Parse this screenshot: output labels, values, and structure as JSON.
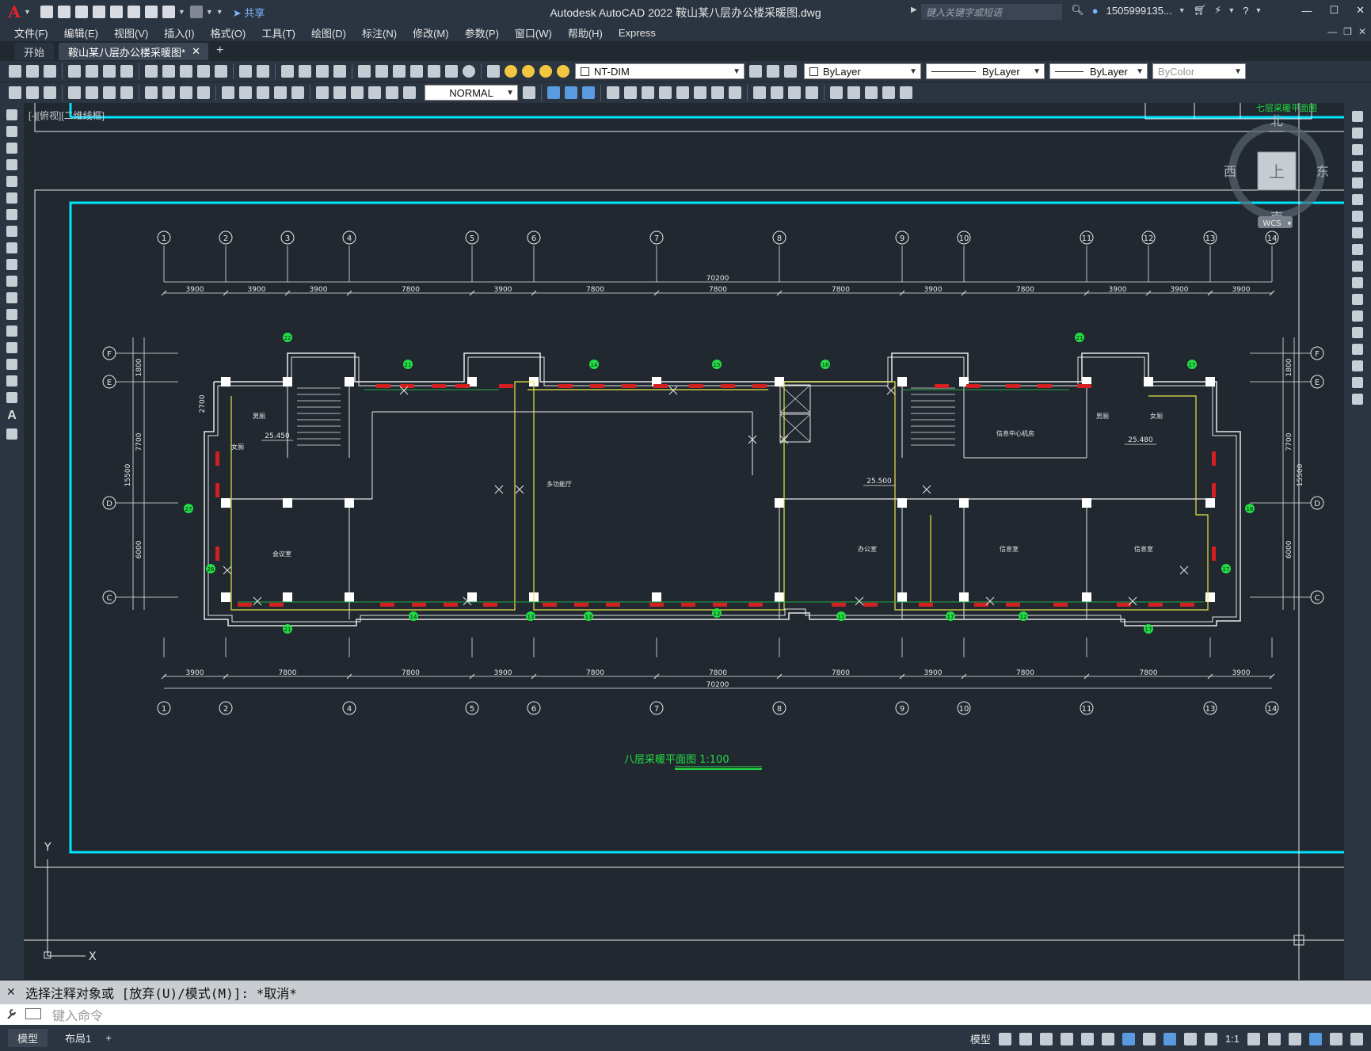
{
  "app": {
    "title": "Autodesk AutoCAD 2022    鞍山某八层办公楼采暖图.dwg",
    "logo": "A",
    "share_label": "共享",
    "search_placeholder": "键入关键字或短语",
    "user": "1505999135...",
    "window_controls": [
      "—",
      "☐",
      "✕"
    ]
  },
  "menu": [
    "文件(F)",
    "编辑(E)",
    "视图(V)",
    "插入(I)",
    "格式(O)",
    "工具(T)",
    "绘图(D)",
    "标注(N)",
    "修改(M)",
    "参数(P)",
    "窗口(W)",
    "帮助(H)",
    "Express"
  ],
  "tabs": {
    "start": "开始",
    "active": "鞍山某八层办公楼采暖图*",
    "add": "+"
  },
  "toolbar": {
    "layer_name": "NT-DIM",
    "color": "ByLayer",
    "linetype": "ByLayer",
    "lineweight": "ByLayer",
    "plotstyle": "ByColor",
    "dimstyle": "NORMAL"
  },
  "view": {
    "label": "[-][俯视][二维线框]",
    "viewcube": {
      "north": "北",
      "south": "南",
      "east": "东",
      "west": "西",
      "face": "上",
      "wcs": "WCS"
    },
    "ucs": {
      "x": "X",
      "y": "Y"
    }
  },
  "drawing": {
    "plan_title": "八层采暖平面图 1:100",
    "upper_title": "七层采暖平面图",
    "grid_top": [
      "1",
      "2",
      "3",
      "4",
      "5",
      "6",
      "7",
      "8",
      "9",
      "10",
      "11",
      "12",
      "13",
      "14"
    ],
    "grid_bottom": [
      "1",
      "2",
      "4",
      "5",
      "6",
      "7",
      "8",
      "9",
      "10",
      "11",
      "13",
      "14"
    ],
    "grid_rows": [
      "F",
      "E",
      "D",
      "C"
    ],
    "dims_top_total": "70200",
    "dims_top": [
      "3900",
      "3900",
      "3900",
      "7800",
      "3900",
      "7800",
      "7800",
      "7800",
      "3900",
      "7800",
      "3900",
      "3900",
      "3900"
    ],
    "dims_bottom_total": "70200",
    "dims_bottom": [
      "3900",
      "7800",
      "7800",
      "3900",
      "7800",
      "7800",
      "7800",
      "3900",
      "7800",
      "7800",
      "3900"
    ],
    "dims_left": [
      "1800",
      "2700",
      "7700",
      "15500",
      "6000"
    ],
    "dims_right": [
      "1800",
      "7700",
      "15500",
      "6000"
    ],
    "room_labels": [
      "多功能厅",
      "会议室",
      "办公室",
      "信息室",
      "信息室",
      "信息中心机房",
      "男厕",
      "女厕",
      "男厕",
      "女厕"
    ],
    "elevations": [
      "25.450",
      "25.480",
      "25.500"
    ],
    "radiator_tags_top": [
      "21",
      "14",
      "15",
      "16",
      "22",
      "21",
      "17"
    ],
    "radiator_tags_bottom": [
      "21",
      "14",
      "13",
      "13",
      "12",
      "11",
      "17",
      "12",
      "17"
    ],
    "radiator_tags_side": [
      "27",
      "26",
      "16",
      "17"
    ]
  },
  "command": {
    "history": "选择注释对象或 [放弃(U)/模式(M)]: *取消*",
    "close": "✕",
    "placeholder": "键入命令"
  },
  "status": {
    "model_tab": "模型",
    "layout_tab": "布局1",
    "add": "+",
    "model_label": "模型",
    "scale": "1:1"
  },
  "colors": {
    "cyan_border": "#00e5ff",
    "pipe_yellow": "#e6e64a",
    "radiator_red": "#d42020",
    "tag_green": "#22dd44",
    "wall_white": "#e8e8e8"
  }
}
